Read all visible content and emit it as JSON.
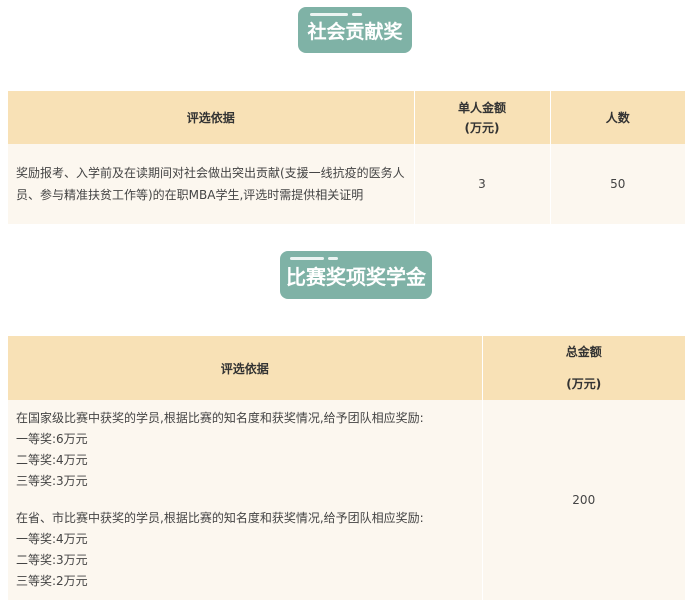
{
  "section1": {
    "title": "社会贡献奖",
    "headers": {
      "criteria": "评选依据",
      "amount_line1": "单人金额",
      "amount_line2": "(万元)",
      "people": "人数"
    },
    "row": {
      "criteria": "奖励报考、入学前及在读期间对社会做出突出贡献(支援一线抗疫的医务人员、参与精准扶贫工作等)的在职MBA学生,评选时需提供相关证明",
      "amount": "3",
      "people": "50"
    }
  },
  "section2": {
    "title": "比赛奖项奖学金",
    "headers": {
      "criteria": "评选依据",
      "total_line1": "总金额",
      "total_line2": "(万元)"
    },
    "national": {
      "intro": "在国家级比赛中获奖的学员,根据比赛的知名度和获奖情况,给予团队相应奖励:",
      "first": "一等奖:6万元",
      "second": "二等奖:4万元",
      "third": "三等奖:3万元"
    },
    "provincial": {
      "intro": "在省、市比赛中获奖的学员,根据比赛的知名度和获奖情况,给予团队相应奖励:",
      "first": "一等奖:4万元",
      "second": "二等奖:3万元",
      "third": "三等奖:2万元"
    },
    "total": "200"
  }
}
